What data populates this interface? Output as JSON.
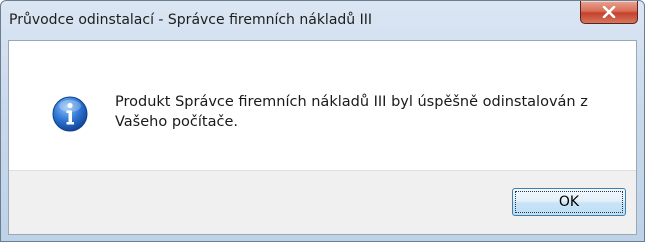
{
  "window": {
    "title": "Průvodce odinstalací - Správce firemních nákladů III"
  },
  "message": {
    "icon": "info-icon",
    "text": "Produkt Správce firemních nákladů III byl úspěšně odinstalován z Vašeho počítače."
  },
  "buttons": {
    "ok_label": "OK",
    "close_icon": "close-icon"
  },
  "colors": {
    "close_button": "#c4422c",
    "info_icon": "#1b5fb8",
    "ok_border": "#3c7fb1"
  }
}
